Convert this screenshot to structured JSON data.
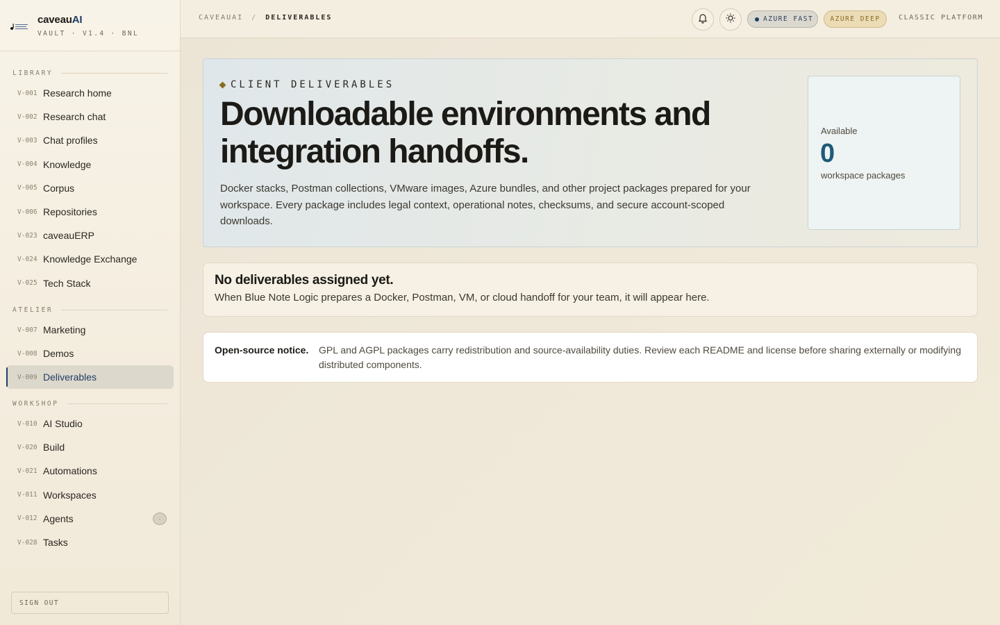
{
  "brand": {
    "name": "caveau",
    "name_accent": "AI",
    "subtitle": "VAULT · V1.4 · BNL",
    "logo_icon": "brand-logo"
  },
  "sidebar": {
    "sections": [
      {
        "label": "LIBRARY",
        "items": [
          {
            "code": "V-001",
            "label": "Research home"
          },
          {
            "code": "V-002",
            "label": "Research chat"
          },
          {
            "code": "V-003",
            "label": "Chat profiles"
          },
          {
            "code": "V-004",
            "label": "Knowledge"
          },
          {
            "code": "V-005",
            "label": "Corpus"
          },
          {
            "code": "V-006",
            "label": "Repositories"
          },
          {
            "code": "V-023",
            "label": "caveauERP"
          },
          {
            "code": "V-024",
            "label": "Knowledge Exchange"
          },
          {
            "code": "V-025",
            "label": "Tech Stack"
          }
        ]
      },
      {
        "label": "ATELIER",
        "items": [
          {
            "code": "V-007",
            "label": "Marketing"
          },
          {
            "code": "V-008",
            "label": "Demos"
          },
          {
            "code": "V-009",
            "label": "Deliverables",
            "active": true
          }
        ]
      },
      {
        "label": "WORKSHOP",
        "items": [
          {
            "code": "V-010",
            "label": "AI Studio"
          },
          {
            "code": "V-020",
            "label": "Build"
          },
          {
            "code": "V-021",
            "label": "Automations"
          },
          {
            "code": "V-011",
            "label": "Workspaces"
          },
          {
            "code": "V-012",
            "label": "Agents",
            "badge": "·"
          },
          {
            "code": "V-028",
            "label": "Tasks"
          }
        ]
      }
    ],
    "signout_label": "SIGN OUT"
  },
  "topbar": {
    "breadcrumb": [
      "CAVEAUAI",
      "DELIVERABLES"
    ],
    "breadcrumb_separator": "/",
    "notifications_icon": "bell-icon",
    "theme_icon": "sun-icon",
    "azure_fast_label": "AZURE FAST",
    "azure_deep_label": "AZURE DEEP",
    "classic_label": "CLASSIC PLATFORM"
  },
  "hero": {
    "eyebrow": "CLIENT DELIVERABLES",
    "title": "Downloadable environments and integration handoffs.",
    "description": "Docker stacks, Postman collections, VMware images, Azure bundles, and other project packages prepared for your workspace. Every package includes legal context, operational notes, checksums, and secure account-scoped downloads.",
    "stat": {
      "label": "Available",
      "value": "0",
      "unit": "workspace packages"
    }
  },
  "empty_state": {
    "title": "No deliverables assigned yet.",
    "body": "When Blue Note Logic prepares a Docker, Postman, VM, or cloud handoff for your team, it will appear here."
  },
  "notice": {
    "title": "Open-source notice.",
    "text": "GPL and AGPL packages carry redistribution and source-availability duties. Review each README and license before sharing externally or modifying distributed components."
  },
  "colors": {
    "accent": "#1f3d66",
    "gold": "#8a6b22",
    "stat_number": "#1f5a78"
  }
}
